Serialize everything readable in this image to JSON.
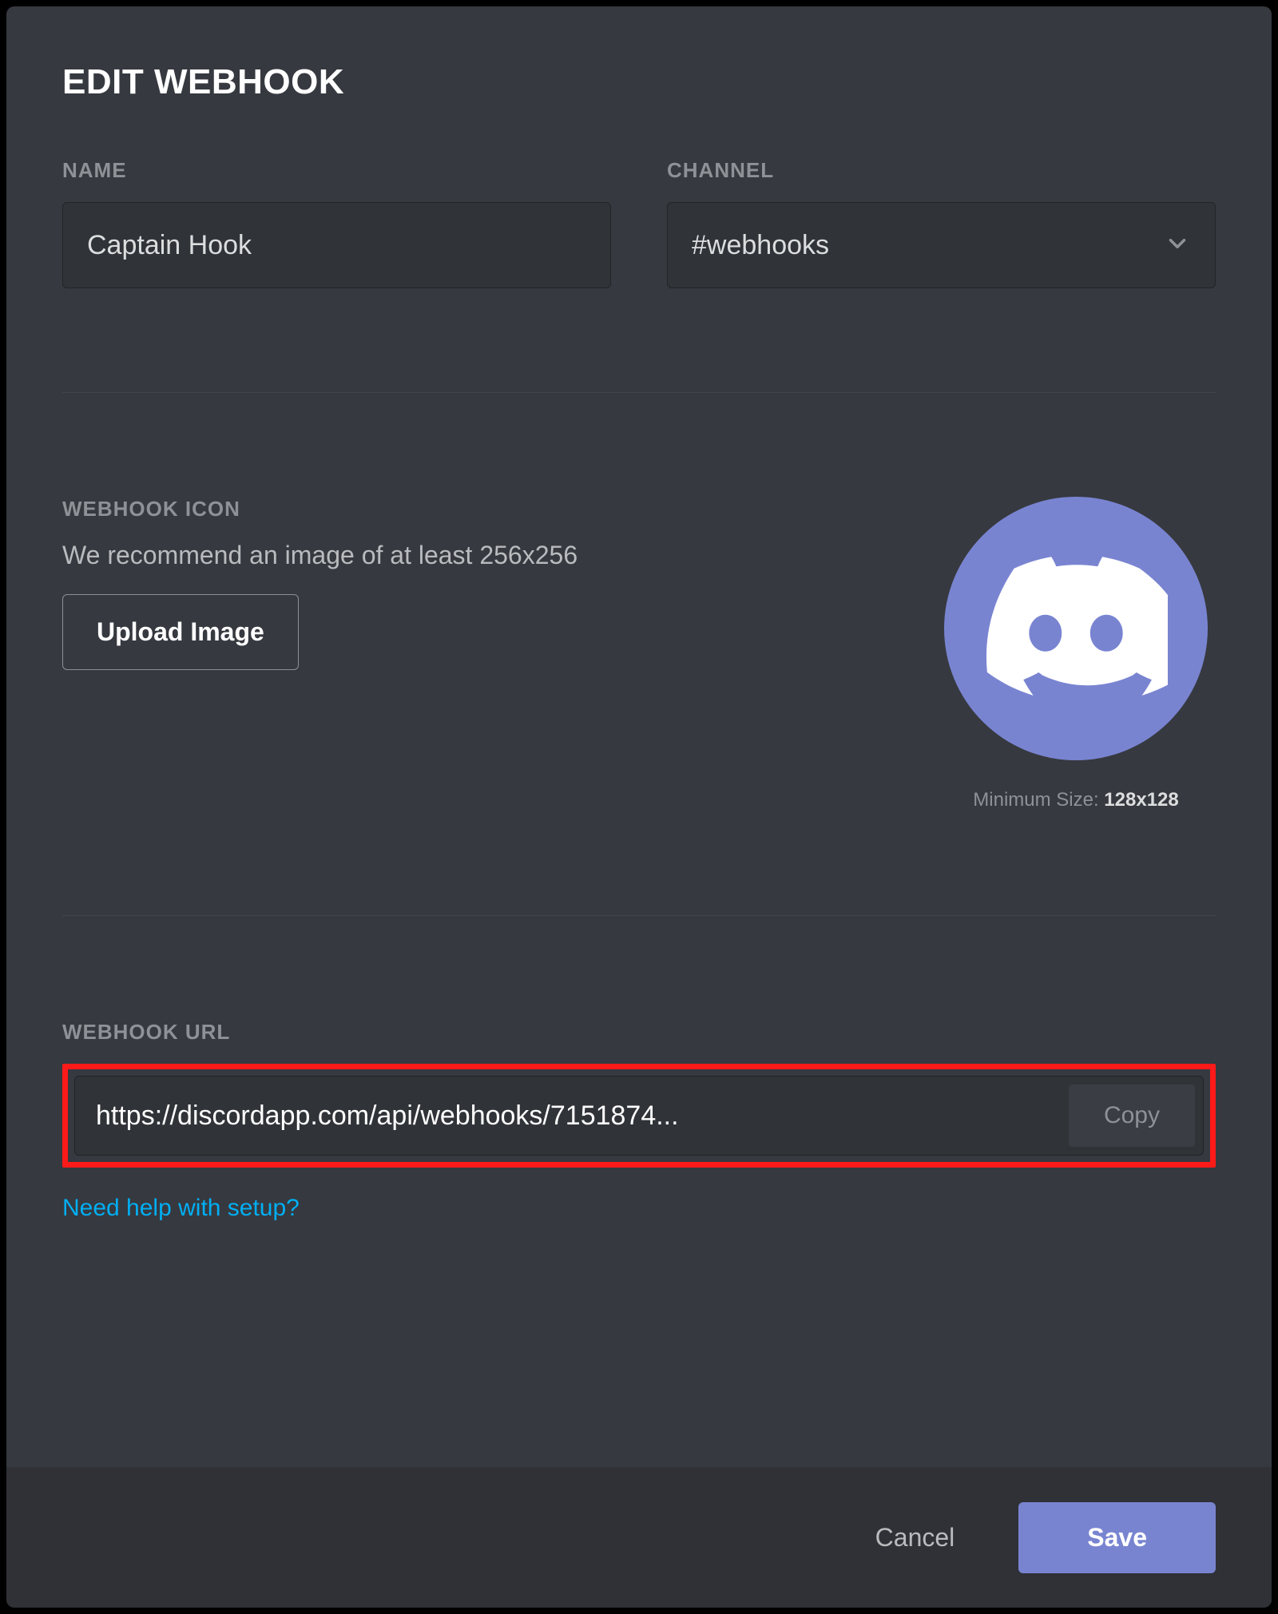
{
  "modal": {
    "title": "EDIT WEBHOOK"
  },
  "name_field": {
    "label": "NAME",
    "value": "Captain Hook"
  },
  "channel_field": {
    "label": "CHANNEL",
    "value": "#webhooks"
  },
  "icon_section": {
    "label": "WEBHOOK ICON",
    "recommend": "We recommend an image of at least 256x256",
    "upload_label": "Upload Image",
    "min_size_prefix": "Minimum Size: ",
    "min_size_value": "128x128"
  },
  "url_section": {
    "label": "WEBHOOK URL",
    "value": "https://discordapp.com/api/webhooks/7151874...",
    "copy_label": "Copy",
    "help_text": "Need help with setup?"
  },
  "footer": {
    "cancel_label": "Cancel",
    "save_label": "Save"
  },
  "colors": {
    "blurple": "#7984d1",
    "highlight_border": "#ff1a1a",
    "link": "#00aff4"
  }
}
